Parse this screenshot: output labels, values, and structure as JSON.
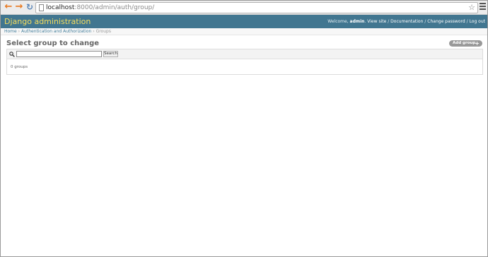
{
  "browser": {
    "url_host": "localhost",
    "url_rest": ":8000/admin/auth/group/",
    "icons": {
      "back": "back-arrow-icon",
      "forward": "forward-arrow-icon",
      "reload": "reload-icon",
      "page": "page-icon",
      "bookmark": "star-icon",
      "menu": "hamburger-menu-icon"
    }
  },
  "header": {
    "branding": "Django administration",
    "welcome": "Welcome,",
    "username": "admin",
    "view_site": "View site",
    "documentation": "Documentation",
    "change_password": "Change password",
    "log_out": "Log out",
    "separator": "/"
  },
  "breadcrumbs": {
    "home": "Home",
    "app": "Authentication and Authorization",
    "current": "Groups",
    "separator": "›"
  },
  "content": {
    "title": "Select group to change",
    "add_button": "Add group",
    "add_icon": "+",
    "search": {
      "value": "",
      "button": "Search"
    },
    "result_count": "0 groups"
  },
  "colors": {
    "header_bg": "#417690",
    "branding": "#f5dd5d",
    "link": "#447e9b",
    "add_button_bg": "#999999"
  }
}
